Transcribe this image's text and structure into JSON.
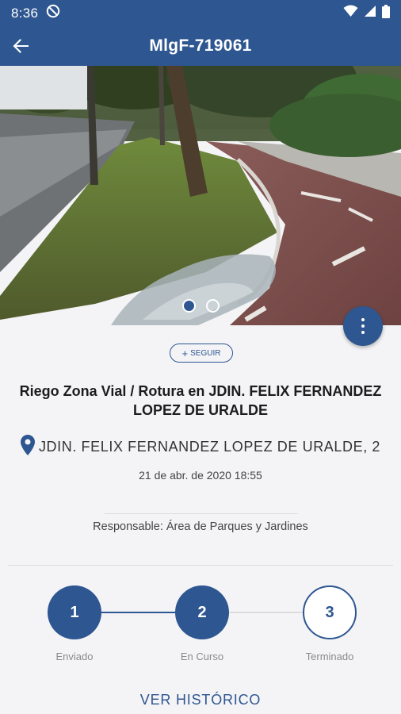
{
  "status_bar": {
    "time": "8:36",
    "icons": [
      "do-not-disturb-icon",
      "wifi-icon",
      "signal-icon",
      "battery-icon"
    ]
  },
  "app_bar": {
    "title": "MlgF-719061",
    "back_icon": "arrow-back-icon"
  },
  "photo": {
    "description_icon": "incident-photo",
    "carousel_total": 2,
    "carousel_active": 1
  },
  "fab": {
    "icon": "more-vert-icon"
  },
  "follow_button": {
    "icon": "+",
    "label": "SEGUIR"
  },
  "incident": {
    "title": "Riego Zona Vial / Rotura en JDIN. FELIX FERNANDEZ LOPEZ DE URALDE",
    "address": "JDIN. FELIX FERNANDEZ LOPEZ DE URALDE, 2",
    "date": "21 de abr. de 2020 18:55",
    "responsible": "Responsable: Área de Parques y Jardines"
  },
  "steps": [
    {
      "number": "1",
      "label": "Enviado",
      "state": "done"
    },
    {
      "number": "2",
      "label": "En Curso",
      "state": "done"
    },
    {
      "number": "3",
      "label": "Terminado",
      "state": "pending"
    }
  ],
  "history_button": {
    "label": "VER HISTÓRICO"
  },
  "colors": {
    "primary": "#2e5690",
    "background": "#f4f4f7",
    "muted_text": "#8a8a8a"
  }
}
